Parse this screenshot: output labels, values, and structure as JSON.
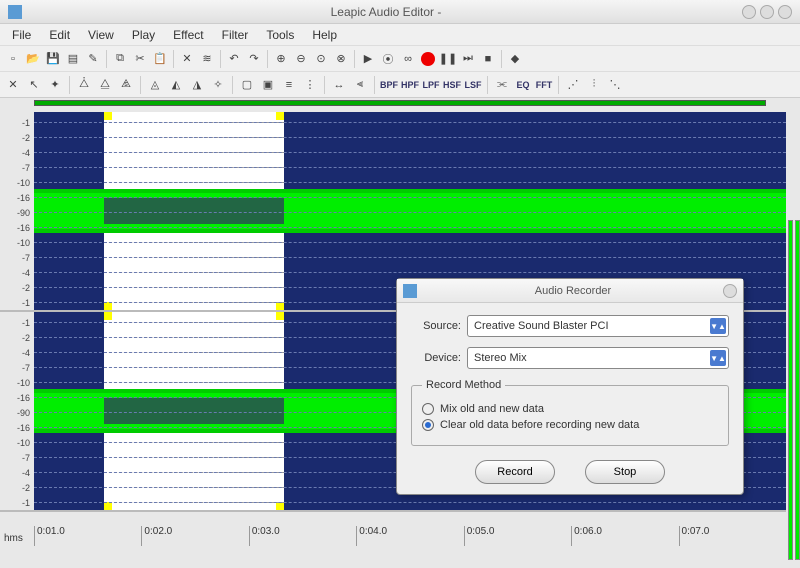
{
  "window": {
    "title": "Leapic Audio Editor -"
  },
  "menu": {
    "items": [
      "File",
      "Edit",
      "View",
      "Play",
      "Effect",
      "Filter",
      "Tools",
      "Help"
    ]
  },
  "toolbar1_names": [
    "new",
    "open",
    "save",
    "save-as",
    "properties",
    "copy",
    "cut",
    "paste",
    "delete",
    "mix",
    "undo",
    "redo",
    "zoom-in",
    "zoom-out",
    "zoom-sel",
    "zoom-all",
    "play",
    "play-loop",
    "loop",
    "record",
    "pause",
    "forward",
    "stop",
    "help"
  ],
  "toolbar2": {
    "names": [
      "sel-all",
      "sel-left",
      "marker",
      "amp-wave",
      "amp-sel",
      "echo",
      "phase",
      "flanger",
      "chorus",
      "effect1",
      "effect2",
      "effect-sel",
      "effect3",
      "effect4",
      "reverse",
      "volume",
      "fade",
      "bpf",
      "hpf",
      "lpf",
      "hsf",
      "lsf",
      "fft1",
      "eq",
      "fft",
      "tool1",
      "tool2",
      "tool3"
    ],
    "bpf": "BPF",
    "hpf": "HPF",
    "lpf": "LPF",
    "hsf": "HSF",
    "lsf": "LSF",
    "eq": "EQ",
    "fft": "FFT"
  },
  "ruler": {
    "labels": [
      "-1",
      "-2",
      "-4",
      "-7",
      "-10",
      "-16",
      "-90",
      "-16",
      "-10",
      "-7",
      "-4",
      "-2",
      "-1"
    ]
  },
  "timeline": {
    "hms": "hms",
    "ticks": [
      "0:01.0",
      "0:02.0",
      "0:03.0",
      "0:04.0",
      "0:05.0",
      "0:06.0",
      "0:07.0"
    ]
  },
  "dialog": {
    "title": "Audio Recorder",
    "source_label": "Source:",
    "source_value": "Creative Sound Blaster PCI",
    "device_label": "Device:",
    "device_value": "Stereo Mix",
    "method_legend": "Record Method",
    "opt_mix": "Mix old and new data",
    "opt_clear": "Clear old data before recording new data",
    "record": "Record",
    "stop": "Stop"
  }
}
